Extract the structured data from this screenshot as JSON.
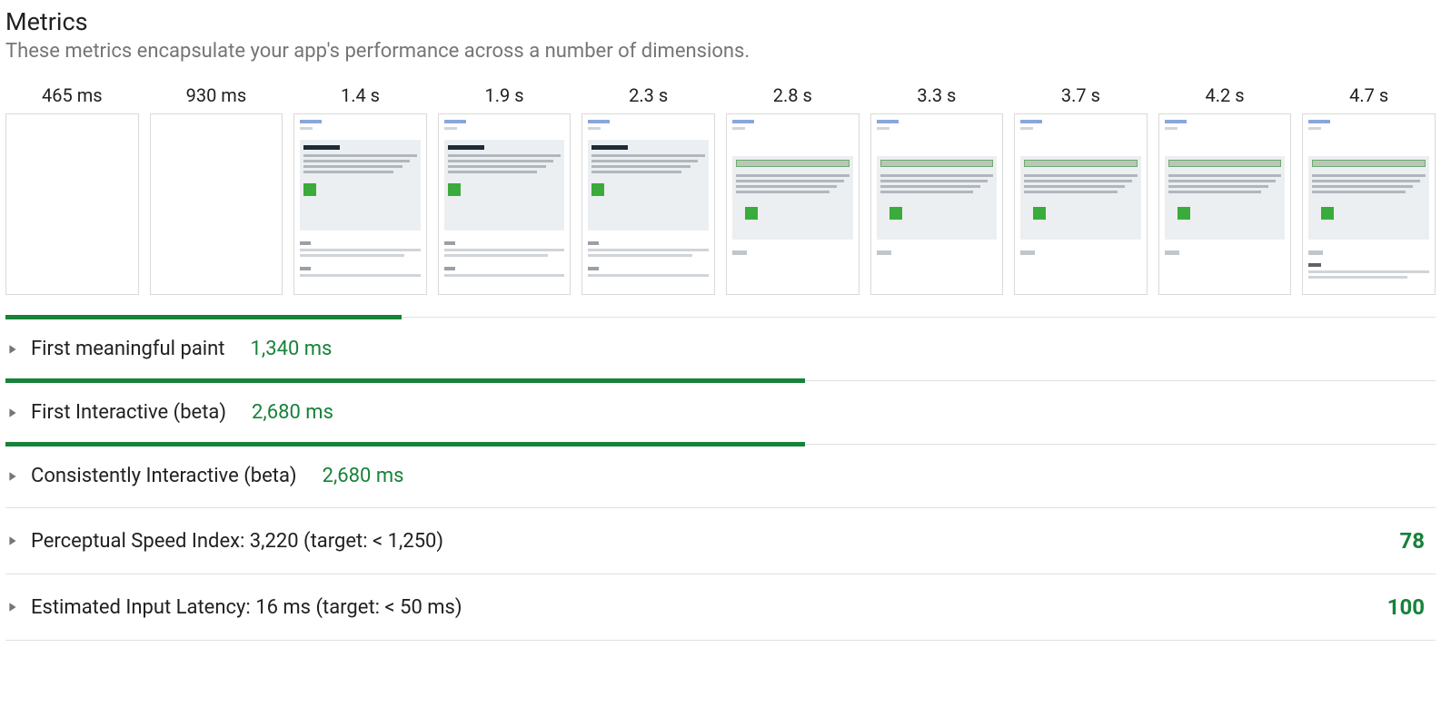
{
  "header": {
    "title": "Metrics",
    "subtitle": "These metrics encapsulate your app's performance across a number of dimensions."
  },
  "filmstrip": {
    "frames": [
      {
        "time": "465 ms",
        "kind": "blank"
      },
      {
        "time": "930 ms",
        "kind": "blank"
      },
      {
        "time": "1.4 s",
        "kind": "A"
      },
      {
        "time": "1.9 s",
        "kind": "A"
      },
      {
        "time": "2.3 s",
        "kind": "A"
      },
      {
        "time": "2.8 s",
        "kind": "B"
      },
      {
        "time": "3.3 s",
        "kind": "B"
      },
      {
        "time": "3.7 s",
        "kind": "B"
      },
      {
        "time": "4.2 s",
        "kind": "B"
      },
      {
        "time": "4.7 s",
        "kind": "Bfoot"
      }
    ]
  },
  "metrics": [
    {
      "label": "First meaningful paint",
      "value": "1,340 ms",
      "bar_pct": 27.7,
      "score": null
    },
    {
      "label": "First Interactive (beta)",
      "value": "2,680 ms",
      "bar_pct": 55.9,
      "score": null
    },
    {
      "label": "Consistently Interactive (beta)",
      "value": "2,680 ms",
      "bar_pct": 55.9,
      "score": null
    },
    {
      "label": "Perceptual Speed Index: 3,220 (target: < 1,250)",
      "value": null,
      "bar_pct": null,
      "score": "78"
    },
    {
      "label": "Estimated Input Latency: 16 ms (target: < 50 ms)",
      "value": null,
      "bar_pct": null,
      "score": "100"
    }
  ],
  "colors": {
    "green": "#178239",
    "muted": "#757575",
    "border": "#e0e0e0"
  }
}
